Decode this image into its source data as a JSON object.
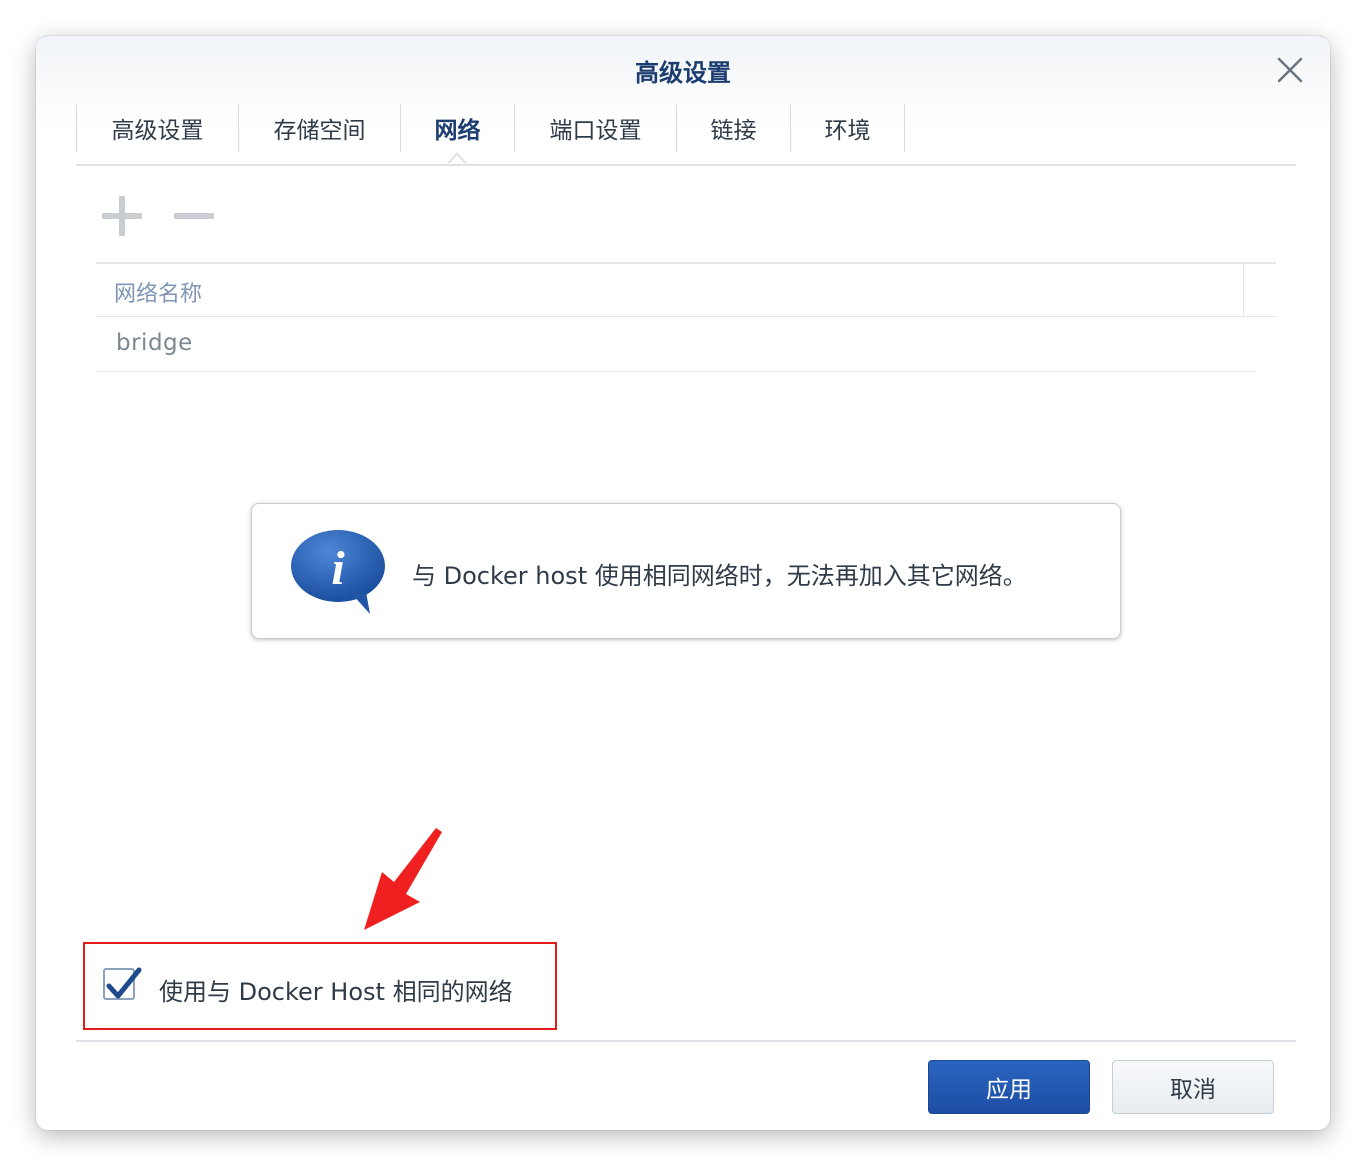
{
  "dialog": {
    "title": "高级设置",
    "close_icon": "close-icon"
  },
  "tabs": [
    {
      "label": "高级设置",
      "active": false
    },
    {
      "label": "存储空间",
      "active": false
    },
    {
      "label": "网络",
      "active": true
    },
    {
      "label": "端口设置",
      "active": false
    },
    {
      "label": "链接",
      "active": false
    },
    {
      "label": "环境",
      "active": false
    }
  ],
  "toolbar": {
    "add_icon": "plus-icon",
    "remove_icon": "minus-icon"
  },
  "network_table": {
    "columns": [
      "网络名称"
    ],
    "rows": [
      [
        "bridge"
      ]
    ]
  },
  "info": {
    "icon": "info-bubble-icon",
    "message": "与 Docker host 使用相同网络时，无法再加入其它网络。"
  },
  "host_network": {
    "checked": true,
    "label": "使用与 Docker Host 相同的网络"
  },
  "footer": {
    "apply_label": "应用",
    "cancel_label": "取消"
  },
  "colors": {
    "accent": "#1c3d70",
    "primary_button": "#2a64c0",
    "annotation": "#e51b1b"
  }
}
